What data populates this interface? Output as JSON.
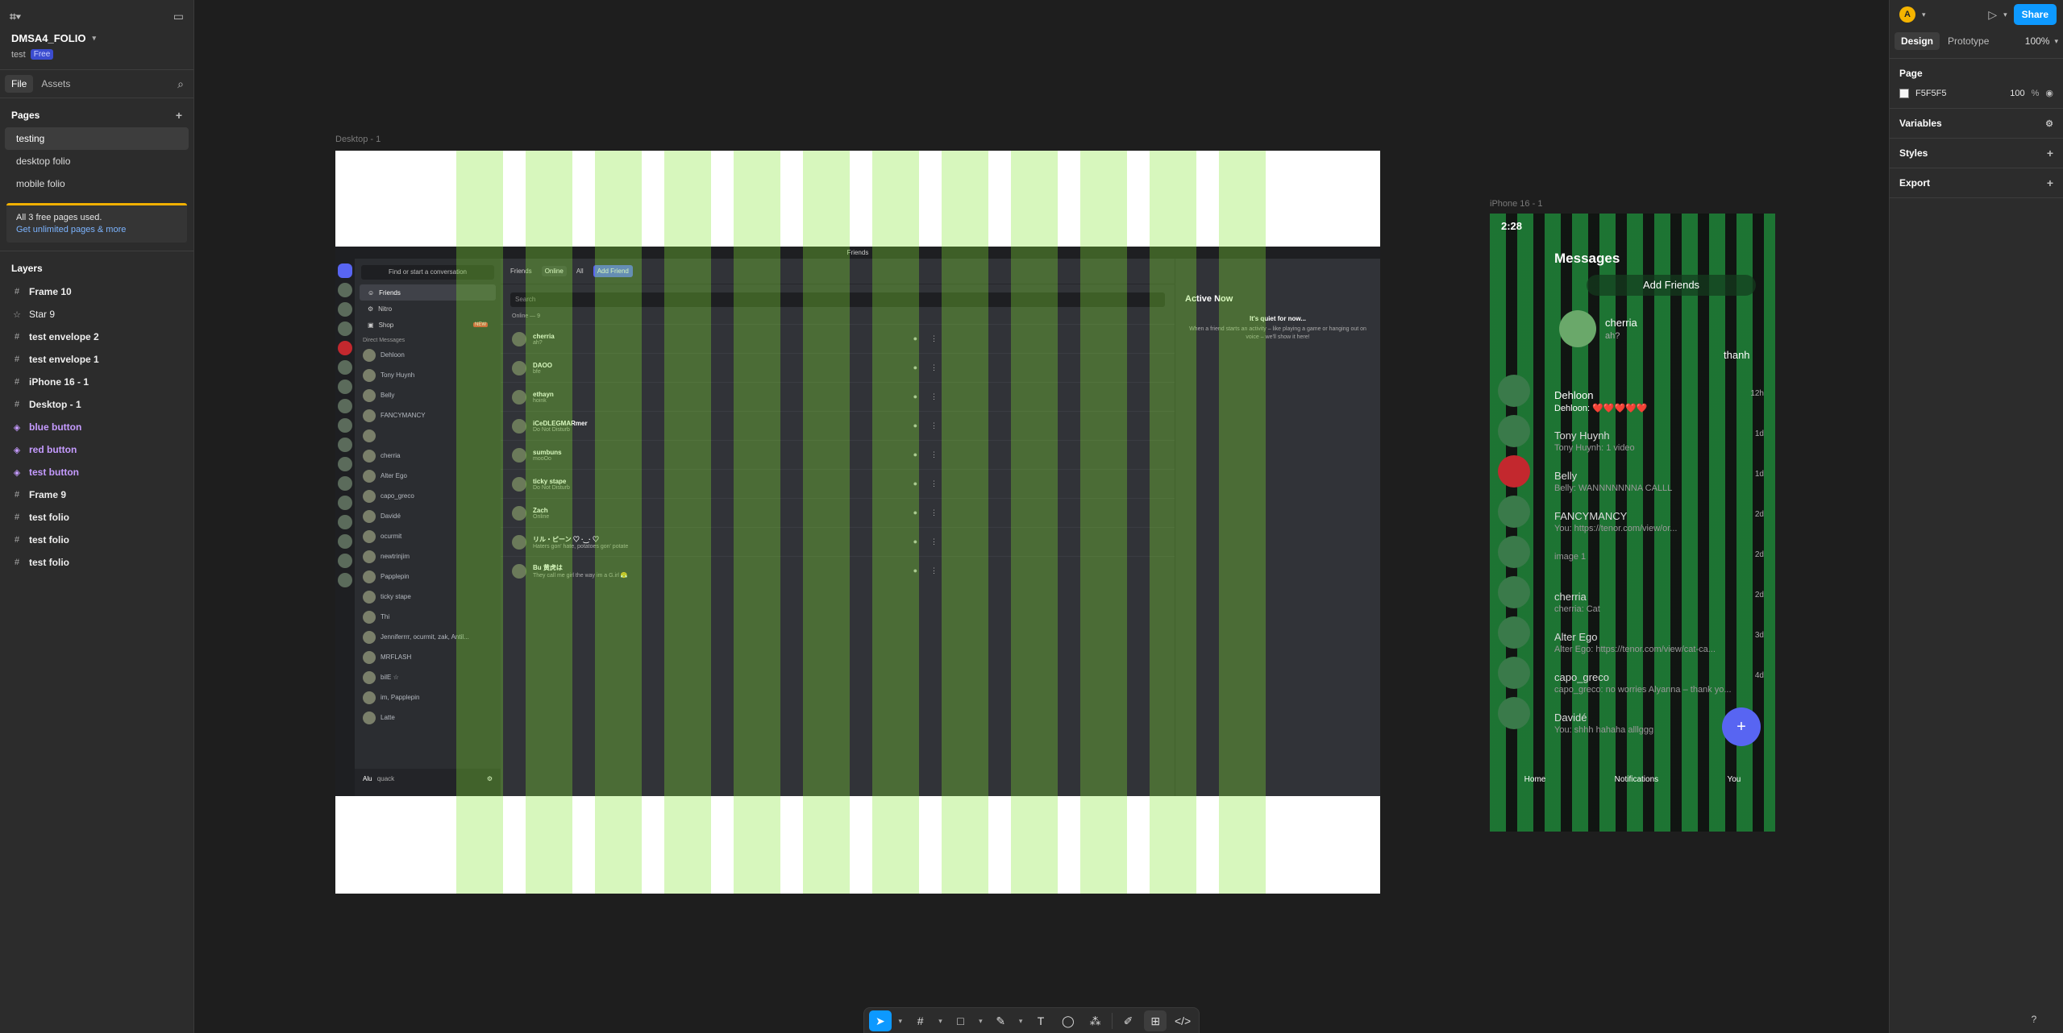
{
  "project": {
    "name": "DMSA4_FOLIO",
    "subtitle": "test",
    "plan": "Free"
  },
  "left_tabs": [
    "File",
    "Assets"
  ],
  "pages": {
    "title": "Pages",
    "items": [
      "testing",
      "desktop folio",
      "mobile folio"
    ],
    "active": "testing",
    "upsell_text": "All 3 free pages used.",
    "upsell_link": "Get unlimited pages & more"
  },
  "layers": {
    "title": "Layers",
    "items": [
      {
        "label": "Frame 10",
        "icon": "frame-icon",
        "kind": "frame"
      },
      {
        "label": "Star 9",
        "icon": "star-icon",
        "kind": "shape"
      },
      {
        "label": "test envelope 2",
        "icon": "frame-icon",
        "kind": "frame"
      },
      {
        "label": "test envelope 1",
        "icon": "frame-icon",
        "kind": "frame"
      },
      {
        "label": "iPhone 16 - 1",
        "icon": "frame-icon",
        "kind": "frame"
      },
      {
        "label": "Desktop - 1",
        "icon": "frame-icon",
        "kind": "frame"
      },
      {
        "label": "blue button",
        "icon": "component-icon",
        "kind": "component"
      },
      {
        "label": "red button",
        "icon": "component-icon",
        "kind": "component"
      },
      {
        "label": "test button",
        "icon": "component-icon",
        "kind": "component"
      },
      {
        "label": "Frame 9",
        "icon": "frame-icon",
        "kind": "frame"
      },
      {
        "label": "test folio",
        "icon": "frame-icon",
        "kind": "frame"
      },
      {
        "label": "test folio",
        "icon": "frame-icon",
        "kind": "frame"
      },
      {
        "label": "test folio",
        "icon": "frame-icon",
        "kind": "frame"
      }
    ]
  },
  "right_panel": {
    "avatar_letter": "A",
    "share_label": "Share",
    "tabs": [
      "Design",
      "Prototype"
    ],
    "zoom": "100%",
    "page_section": "Page",
    "page_color": "F5F5F5",
    "page_opacity": "100",
    "opacity_unit": "%",
    "sections": [
      "Variables",
      "Styles",
      "Export"
    ]
  },
  "canvas": {
    "desktop_label": "Desktop - 1",
    "iphone_label": "iPhone 16 - 1"
  },
  "discord": {
    "window_title": "Friends",
    "dm_search": "Find or start a conversation",
    "nav": [
      "Friends",
      "Nitro",
      "Shop"
    ],
    "shop_badge": "NEW",
    "dm_header": "Direct Messages",
    "dms": [
      "Dehloon",
      "Tony Huynh",
      "Belly",
      "FANCYMANCY",
      "",
      "cherria",
      "Alter Ego",
      "capo_greco",
      "Davidé",
      "ocurmit",
      "newtrinjim",
      "Papplepin",
      "ticky stape",
      "Thi",
      "Jenniferrrr, ocurmit, zak, Antil...",
      "MRFLASH",
      "bilE ☆",
      "im, Papplepin",
      "Latte"
    ],
    "user": {
      "name": "Alu",
      "status": "quack"
    },
    "tabs": [
      "Friends",
      "Online",
      "All"
    ],
    "add_friend": "Add Friend",
    "search_placeholder": "Search",
    "online_count": "Online — 9",
    "friends": [
      {
        "name": "cherria",
        "status": "ah?"
      },
      {
        "name": "DAOO",
        "status": "bfe"
      },
      {
        "name": "ethayn",
        "status": "hoink"
      },
      {
        "name": "iCeDLEGMARmer",
        "status": "Do Not Disturb"
      },
      {
        "name": "sumbuns",
        "status": "mooOo"
      },
      {
        "name": "ticky stape",
        "status": "Do Not Disturb"
      },
      {
        "name": "Zach",
        "status": "Online"
      },
      {
        "name": "リル・ピーン ♡ ·‿· ♡",
        "status": "Haters gon' hate, potatoes gon' potate"
      },
      {
        "name": "Bu 黄虎は",
        "status": "They call me girl the way im a G.irl 😤"
      }
    ],
    "active_now": {
      "title": "Active Now",
      "quiet": "It's quiet for now...",
      "desc": "When a friend starts an activity – like playing a game or hanging out on voice – we'll show it here!"
    }
  },
  "mobile": {
    "time": "2:28",
    "title": "Messages",
    "add_friends": "Add Friends",
    "story_names": [
      "cherria",
      "thanh"
    ],
    "story_status": "ah?",
    "rows": [
      {
        "name": "Dehloon",
        "msg": "Dehloon: ❤️❤️❤️❤️❤️",
        "time": "12h"
      },
      {
        "name": "Tony Huynh",
        "msg": "Tony Huynh: 1 video",
        "time": "1d"
      },
      {
        "name": "Belly",
        "msg": "Belly: WANNNNNNNA CALLL",
        "time": "1d"
      },
      {
        "name": "FANCYMANCY",
        "msg": "You: https://tenor.com/view/or...",
        "time": "2d"
      },
      {
        "name": "",
        "msg": "image 1",
        "time": "2d"
      },
      {
        "name": "cherria",
        "msg": "cherria: Cat",
        "time": "2d"
      },
      {
        "name": "Alter Ego",
        "msg": "Alter Ego: https://tenor.com/view/cat-ca...",
        "time": "3d"
      },
      {
        "name": "capo_greco",
        "msg": "capo_greco: no worries Alyanna – thank yo...",
        "time": "4d"
      },
      {
        "name": "Davidé",
        "msg": "You: shhh hahaha alllggg",
        "time": ""
      }
    ],
    "nav": [
      "Home",
      "Notifications",
      "You"
    ]
  },
  "colors": {
    "accent": "#0d99ff",
    "grid_overlay": "#82e632",
    "discord_blurple": "#5865f2",
    "upsell_bar": "#f0b000"
  },
  "help_label": "?"
}
